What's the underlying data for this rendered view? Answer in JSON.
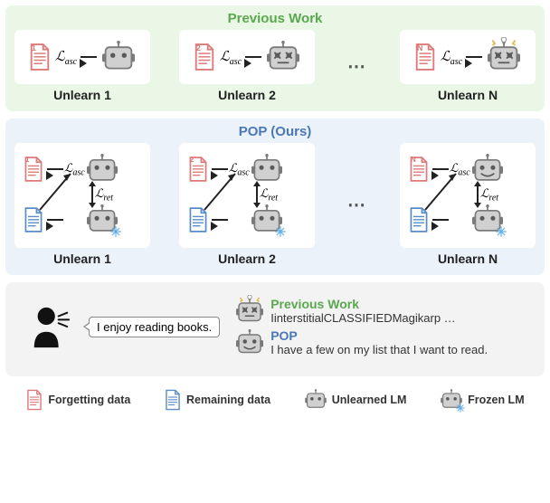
{
  "panels": {
    "previous": {
      "title": "Previous Work",
      "stages": [
        "Unlearn 1",
        "Unlearn 2",
        "Unlearn N"
      ]
    },
    "pop": {
      "title": "POP (Ours)",
      "stages": [
        "Unlearn 1",
        "Unlearn 2",
        "Unlearn N"
      ]
    }
  },
  "losses": {
    "asc_html": "ℒ",
    "asc_sub": "asc",
    "ret_html": "ℒ",
    "ret_sub": "ret"
  },
  "doc_indices": [
    "1",
    "2",
    "N"
  ],
  "conversation": {
    "user_text": "I enjoy reading books.",
    "prev_label": "Previous Work",
    "prev_output": "IinterstitialCLASSIFIEDMagikarp …",
    "pop_label": "POP",
    "pop_output": "I have a few on my list that I want to read."
  },
  "legend": {
    "forgetting": "Forgetting data",
    "remaining": "Remaining data",
    "unlearned": "Unlearned LM",
    "frozen": "Frozen LM"
  },
  "icon_colors": {
    "forgetting_doc": "#dd7a7a",
    "remaining_doc": "#5a8cc7",
    "robot_body": "#bdbdbd",
    "robot_outline": "#7a7a7a",
    "frozen_accent": "#63b1e6",
    "snowflake": "#63b1e6",
    "prev_title": "#5aa84e",
    "pop_title": "#4a77b8"
  }
}
